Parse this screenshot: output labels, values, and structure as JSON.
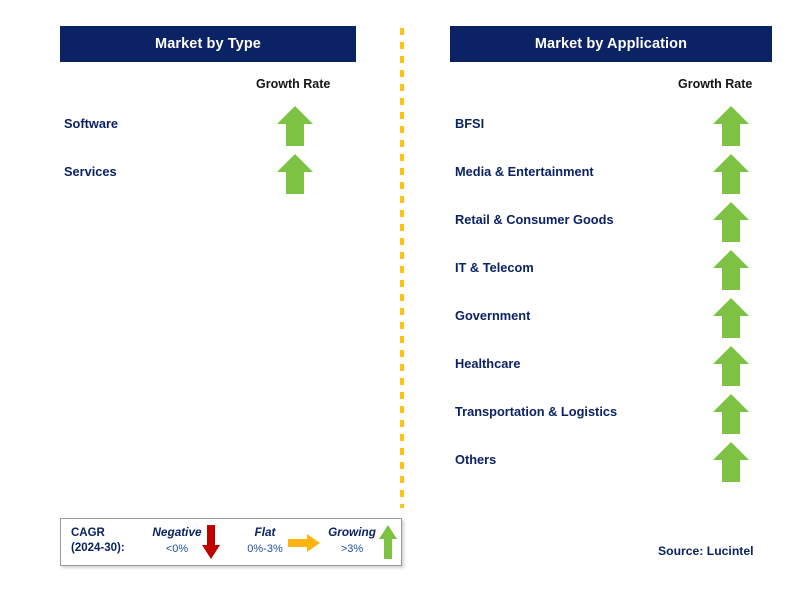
{
  "colors": {
    "header_navy": "#0b2265",
    "label_navy": "#0b2265",
    "arrow_green": "#7dc242",
    "arrow_red": "#c00000",
    "arrow_orange": "#ffb511",
    "divider_amber": "#ffc20e",
    "background": "#ffffff"
  },
  "panels": [
    {
      "id": "market-by-type",
      "title": "Market by Type",
      "growth_rate_label": "Growth Rate",
      "rows": [
        {
          "label": "Software",
          "growth": "growing",
          "icon": "arrow-up-icon"
        },
        {
          "label": "Services",
          "growth": "growing",
          "icon": "arrow-up-icon"
        }
      ]
    },
    {
      "id": "market-by-application",
      "title": "Market by Application",
      "growth_rate_label": "Growth Rate",
      "rows": [
        {
          "label": "BFSI",
          "growth": "growing",
          "icon": "arrow-up-icon"
        },
        {
          "label": "Media & Entertainment",
          "growth": "growing",
          "icon": "arrow-up-icon"
        },
        {
          "label": "Retail & Consumer Goods",
          "growth": "growing",
          "icon": "arrow-up-icon"
        },
        {
          "label": "IT & Telecom",
          "growth": "growing",
          "icon": "arrow-up-icon"
        },
        {
          "label": "Government",
          "growth": "growing",
          "icon": "arrow-up-icon"
        },
        {
          "label": "Healthcare",
          "growth": "growing",
          "icon": "arrow-up-icon"
        },
        {
          "label": "Transportation & Logistics",
          "growth": "growing",
          "icon": "arrow-up-icon"
        },
        {
          "label": "Others",
          "growth": "growing",
          "icon": "arrow-up-icon"
        }
      ]
    }
  ],
  "legend": {
    "title_line1": "CAGR",
    "title_line2": "(2024-30):",
    "items": [
      {
        "word": "Negative",
        "range": "<0%",
        "icon": "arrow-down-icon",
        "color": "#c00000"
      },
      {
        "word": "Flat",
        "range": "0%-3%",
        "icon": "arrow-right-icon",
        "color": "#ffb511"
      },
      {
        "word": "Growing",
        "range": ">3%",
        "icon": "arrow-up-icon",
        "color": "#7dc242"
      }
    ]
  },
  "source": "Source: Lucintel"
}
